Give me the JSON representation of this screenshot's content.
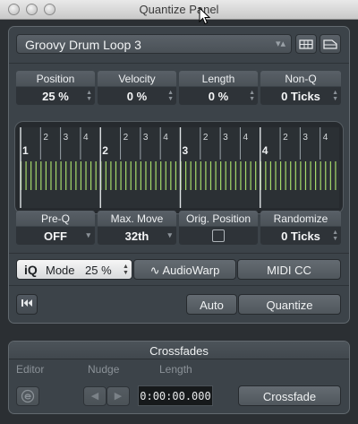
{
  "window": {
    "title": "Quantize Panel"
  },
  "preset": {
    "name": "Groovy Drum Loop 3"
  },
  "params_top": [
    {
      "label": "Position",
      "value": "25 %"
    },
    {
      "label": "Velocity",
      "value": "0 %"
    },
    {
      "label": "Length",
      "value": "0 %"
    },
    {
      "label": "Non-Q",
      "value": "0 Ticks"
    }
  ],
  "grid": {
    "bars": [
      "1",
      "2",
      "3",
      "4"
    ],
    "beats": [
      "2",
      "3",
      "4"
    ],
    "line_color": "#a6d96b"
  },
  "params_bottom": [
    {
      "label": "Pre-Q",
      "value": "OFF"
    },
    {
      "label": "Max. Move",
      "value": "32th"
    },
    {
      "label": "Orig. Position",
      "value": ""
    },
    {
      "label": "Randomize",
      "value": "0 Ticks"
    }
  ],
  "mode_row": {
    "iq_label": "iQ",
    "mode_label": "Mode",
    "mode_value": "25 %",
    "audiowarp_label": "AudioWarp",
    "midicc_label": "MIDI CC"
  },
  "actions": {
    "auto_label": "Auto",
    "quantize_label": "Quantize"
  },
  "crossfades": {
    "title": "Crossfades",
    "editor_label": "Editor",
    "nudge_label": "Nudge",
    "length_label": "Length",
    "length_value": "0:00:00.000",
    "button_label": "Crossfade"
  }
}
